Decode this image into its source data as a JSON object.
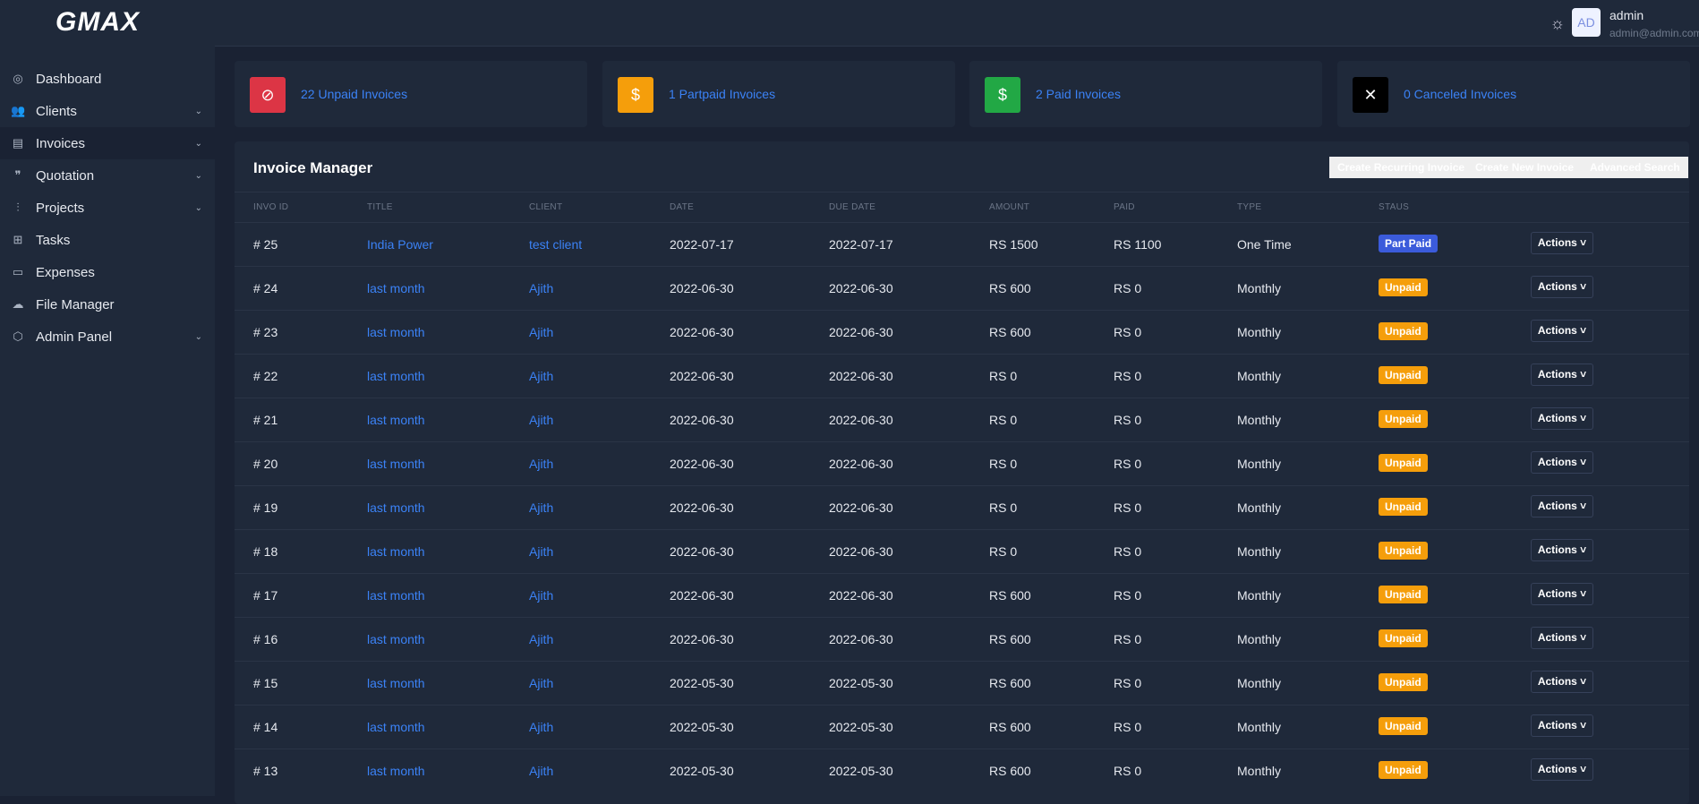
{
  "brand": "GMAX",
  "sidebar": {
    "items": [
      {
        "label": "Dashboard",
        "icon": "dashboard-icon",
        "chevron": false
      },
      {
        "label": "Clients",
        "icon": "users-icon",
        "chevron": true
      },
      {
        "label": "Invoices",
        "icon": "document-icon",
        "chevron": true,
        "active": true
      },
      {
        "label": "Quotation",
        "icon": "quote-icon",
        "chevron": true
      },
      {
        "label": "Projects",
        "icon": "sliders-icon",
        "chevron": true
      },
      {
        "label": "Tasks",
        "icon": "tasks-icon",
        "chevron": false
      },
      {
        "label": "Expenses",
        "icon": "wallet-icon",
        "chevron": false
      },
      {
        "label": "File Manager",
        "icon": "cloud-upload-icon",
        "chevron": false
      },
      {
        "label": "Admin Panel",
        "icon": "box-icon",
        "chevron": true
      }
    ]
  },
  "user": {
    "initials": "AD",
    "name": "admin",
    "email": "admin@admin.com"
  },
  "cards": [
    {
      "label": "22 Unpaid Invoices",
      "color": "#dc3545",
      "glyph": "⊘"
    },
    {
      "label": "1 Partpaid Invoices",
      "color": "#f59e0b",
      "glyph": "$"
    },
    {
      "label": "2 Paid Invoices",
      "color": "#22a845",
      "glyph": "$"
    },
    {
      "label": "0 Canceled Invoices",
      "color": "#000000",
      "glyph": "✕"
    }
  ],
  "panel": {
    "title": "Invoice Manager",
    "buttons": [
      {
        "label": "Create Recurring Invoice",
        "color": "#f56a0a"
      },
      {
        "label": "Create New Invoice",
        "color": "#2eaa45"
      },
      {
        "label": "Advanced Search",
        "color": "#1f6fd1"
      }
    ]
  },
  "table": {
    "headers": [
      "INVO ID",
      "TITLE",
      "CLIENT",
      "DATE",
      "DUE DATE",
      "AMOUNT",
      "PAID",
      "TYPE",
      "STAUS"
    ],
    "action_label": "Actions ˅",
    "rows": [
      [
        "# 25",
        "India Power",
        "test client",
        "2022-07-17",
        "2022-07-17",
        "RS 1500",
        "RS 1100",
        "One Time",
        "Part Paid"
      ],
      [
        "# 24",
        "last month",
        "Ajith",
        "2022-06-30",
        "2022-06-30",
        "RS 600",
        "RS 0",
        "Monthly",
        "Unpaid"
      ],
      [
        "# 23",
        "last month",
        "Ajith",
        "2022-06-30",
        "2022-06-30",
        "RS 600",
        "RS 0",
        "Monthly",
        "Unpaid"
      ],
      [
        "# 22",
        "last month",
        "Ajith",
        "2022-06-30",
        "2022-06-30",
        "RS 0",
        "RS 0",
        "Monthly",
        "Unpaid"
      ],
      [
        "# 21",
        "last month",
        "Ajith",
        "2022-06-30",
        "2022-06-30",
        "RS 0",
        "RS 0",
        "Monthly",
        "Unpaid"
      ],
      [
        "# 20",
        "last month",
        "Ajith",
        "2022-06-30",
        "2022-06-30",
        "RS 0",
        "RS 0",
        "Monthly",
        "Unpaid"
      ],
      [
        "# 19",
        "last month",
        "Ajith",
        "2022-06-30",
        "2022-06-30",
        "RS 0",
        "RS 0",
        "Monthly",
        "Unpaid"
      ],
      [
        "# 18",
        "last month",
        "Ajith",
        "2022-06-30",
        "2022-06-30",
        "RS 0",
        "RS 0",
        "Monthly",
        "Unpaid"
      ],
      [
        "# 17",
        "last month",
        "Ajith",
        "2022-06-30",
        "2022-06-30",
        "RS 600",
        "RS 0",
        "Monthly",
        "Unpaid"
      ],
      [
        "# 16",
        "last month",
        "Ajith",
        "2022-06-30",
        "2022-06-30",
        "RS 600",
        "RS 0",
        "Monthly",
        "Unpaid"
      ],
      [
        "# 15",
        "last month",
        "Ajith",
        "2022-05-30",
        "2022-05-30",
        "RS 600",
        "RS 0",
        "Monthly",
        "Unpaid"
      ],
      [
        "# 14",
        "last month",
        "Ajith",
        "2022-05-30",
        "2022-05-30",
        "RS 600",
        "RS 0",
        "Monthly",
        "Unpaid"
      ],
      [
        "# 13",
        "last month",
        "Ajith",
        "2022-05-30",
        "2022-05-30",
        "RS 600",
        "RS 0",
        "Monthly",
        "Unpaid"
      ]
    ]
  },
  "status_colors": {
    "Part Paid": "#3b5bdb",
    "Unpaid": "#f59e0b"
  }
}
